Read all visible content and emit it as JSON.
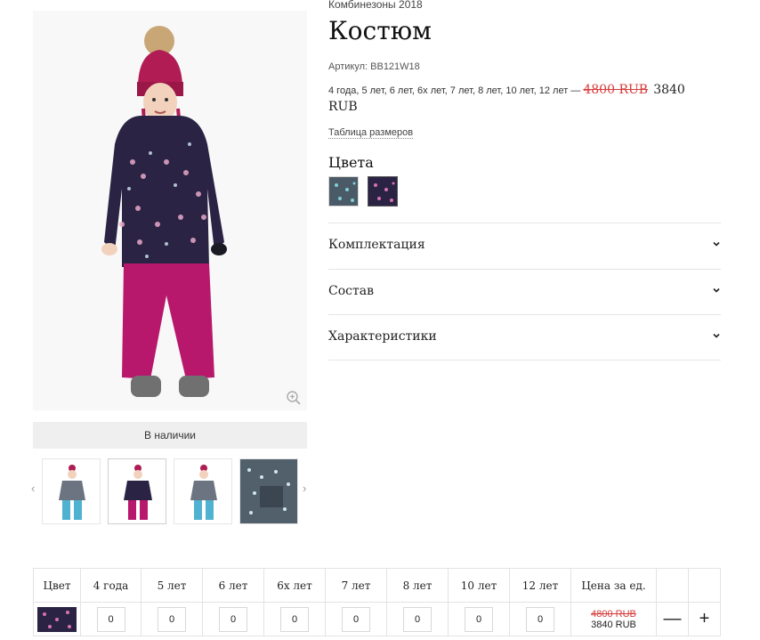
{
  "product": {
    "category": "Комбинезоны 2018",
    "title": "Костюм",
    "sku_label": "Артикул:",
    "sku_value": "BB121W18",
    "sizes_list": "4 года, 5 лет, 6 лет, 6х лет, 7 лет, 8 лет, 10 лет, 12 лет — ",
    "old_price": "4800 RUB",
    "new_price": "3840 RUB",
    "size_table_link": "Таблица размеров",
    "colors_heading": "Цвета",
    "availability": "В наличии"
  },
  "colors": [
    {
      "name": "grey-dots",
      "hex": "#4a5a66"
    },
    {
      "name": "navy-magenta",
      "hex": "#2a2344"
    }
  ],
  "accordion": [
    {
      "label": "Комплектация",
      "icon": "chevron-down-icon"
    },
    {
      "label": "Состав",
      "icon": "chevron-down-icon"
    },
    {
      "label": "Характеристики",
      "icon": "chevron-down-icon"
    }
  ],
  "gallery": {
    "prev_arrow": "‹",
    "next_arrow": "›",
    "zoom_icon": "zoom-in-icon"
  },
  "order_table": {
    "headers": [
      "Цвет",
      "4 года",
      "5 лет",
      "6 лет",
      "6х лет",
      "7 лет",
      "8 лет",
      "10 лет",
      "12 лет",
      "Цена за ед."
    ],
    "rows": [
      {
        "swatch_color": "#2a2344",
        "quantities": [
          "0",
          "0",
          "0",
          "0",
          "0",
          "0",
          "0",
          "0"
        ],
        "old_price": "4800 RUB",
        "new_price": "3840 RUB",
        "minus": "—",
        "plus": "+"
      }
    ]
  },
  "palette": {
    "accent_red": "#d63b3b",
    "jacket_navy": "#2a2344",
    "pants_magenta": "#b8186c"
  }
}
